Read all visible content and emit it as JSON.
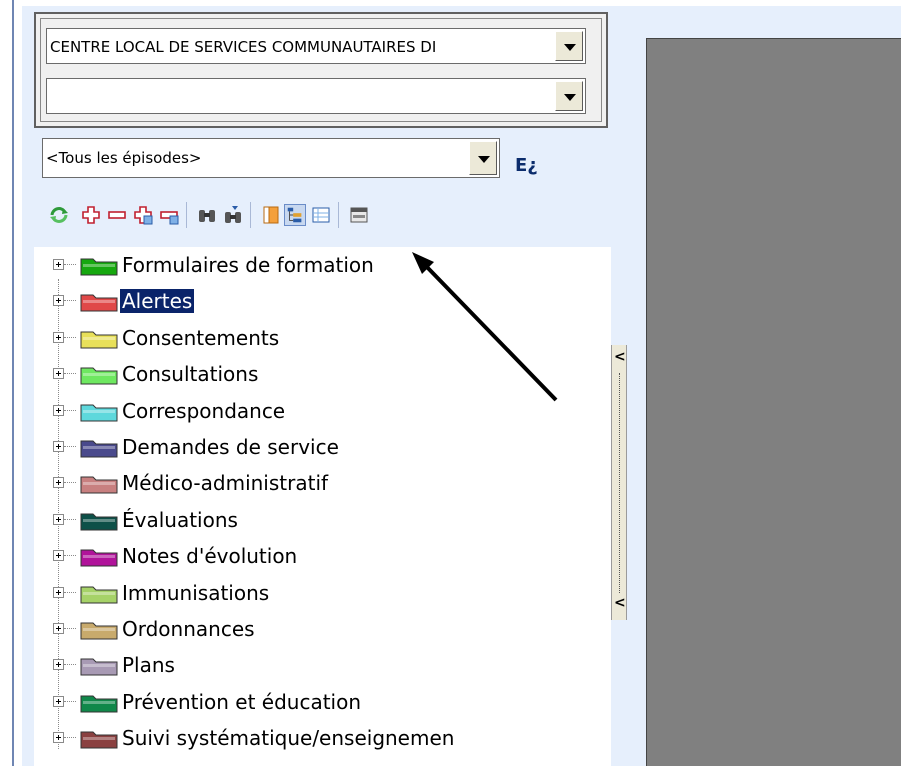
{
  "filters": {
    "establishment": "CENTRE LOCAL DE SERVICES COMMUNAUTAIRES DI",
    "secondary": "",
    "episode": "<Tous les épisodes>",
    "episode_side_label": "E¿"
  },
  "toolbar": {
    "icons": [
      "refresh-icon",
      "add-icon",
      "remove-icon",
      "expand-all-icon",
      "collapse-all-icon",
      "find-icon",
      "find-next-icon",
      "document-view-icon",
      "tree-view-icon",
      "list-view-icon",
      "panel-view-icon"
    ]
  },
  "tree": {
    "items": [
      {
        "label": "Formulaires de formation",
        "color": "#16a80f",
        "selected": false
      },
      {
        "label": "Alertes",
        "color": "#e04848",
        "selected": true
      },
      {
        "label": "Consentements",
        "color": "#e8e05a",
        "selected": false
      },
      {
        "label": "Consultations",
        "color": "#6ee860",
        "selected": false
      },
      {
        "label": "Correspondance",
        "color": "#5ed8dc",
        "selected": false
      },
      {
        "label": "Demandes de service",
        "color": "#4a4a8c",
        "selected": false
      },
      {
        "label": "Médico-administratif",
        "color": "#c88080",
        "selected": false
      },
      {
        "label": "Évaluations",
        "color": "#0d5048",
        "selected": false
      },
      {
        "label": "Notes d'évolution",
        "color": "#b0139a",
        "selected": false
      },
      {
        "label": "Immunisations",
        "color": "#a6d268",
        "selected": false
      },
      {
        "label": "Ordonnances",
        "color": "#c8aa6c",
        "selected": false
      },
      {
        "label": "Plans",
        "color": "#a89ab4",
        "selected": false
      },
      {
        "label": "Prévention et éducation",
        "color": "#10884a",
        "selected": false
      },
      {
        "label": "Suivi systématique/enseignemen",
        "color": "#8a4040",
        "selected": false
      }
    ]
  },
  "splitter": {
    "top_arrow": "<",
    "bottom_arrow": "<"
  },
  "colors": {
    "selection": "#0a246a",
    "panel_bg": "#e6effc",
    "right_panel": "#808080"
  }
}
